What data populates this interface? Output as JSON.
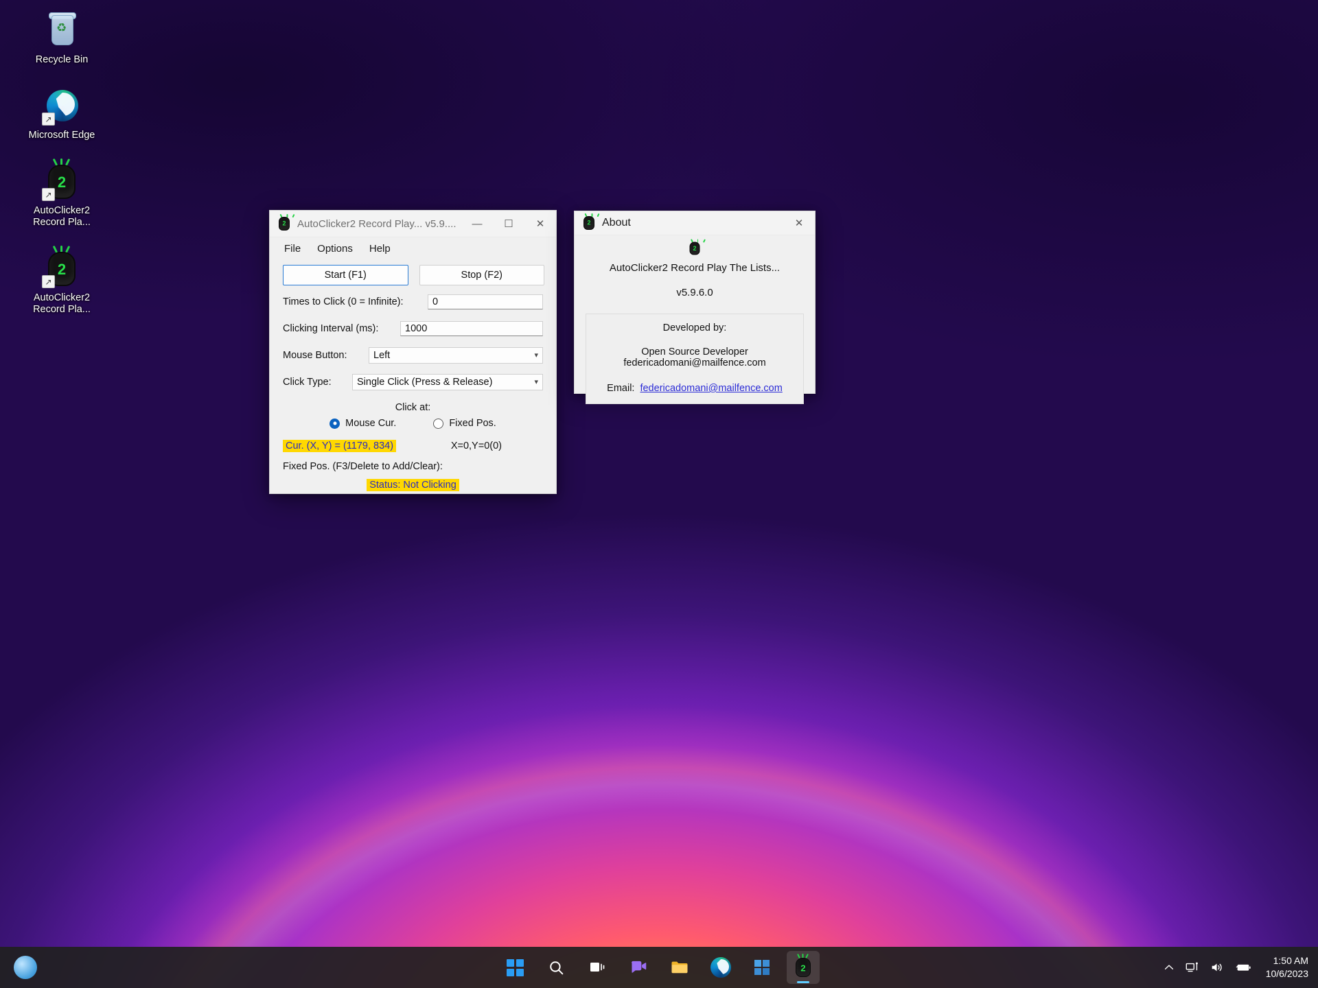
{
  "desktop": {
    "icons": [
      {
        "name": "Recycle Bin",
        "icon": "recycle-bin-icon",
        "shortcut": false
      },
      {
        "name": "Microsoft Edge",
        "icon": "edge-icon",
        "shortcut": true
      },
      {
        "name": "AutoClicker2 Record Pla...",
        "icon": "autoclicker-icon",
        "shortcut": true
      },
      {
        "name": "AutoClicker2 Record Pla...",
        "icon": "autoclicker-icon",
        "shortcut": true
      }
    ]
  },
  "main_window": {
    "title": "AutoClicker2 Record Play... v5.9....",
    "icon": "autoclicker-icon",
    "controls": {
      "minimize": "—",
      "maximize": "☐",
      "close": "✕"
    },
    "menu": [
      "File",
      "Options",
      "Help"
    ],
    "buttons": {
      "start": "Start (F1)",
      "stop": "Stop (F2)"
    },
    "fields": {
      "times_label": "Times to Click (0 = Infinite):",
      "times_value": "0",
      "interval_label": "Clicking Interval (ms):",
      "interval_value": "1000",
      "mouse_button_label": "Mouse Button:",
      "mouse_button_value": "Left",
      "click_type_label": "Click Type:",
      "click_type_value": "Single Click (Press & Release)"
    },
    "click_at": {
      "heading": "Click at:",
      "option_mouse": "Mouse Cur.",
      "option_fixed": "Fixed Pos.",
      "selected": "Mouse Cur."
    },
    "cursor_readout": "Cur. (X, Y) = (1179, 834)",
    "fixed_readout": "X=0,Y=0(0)",
    "fixed_pos_label": "Fixed Pos. (F3/Delete to Add/Clear):",
    "status": "Status:  Not Clicking",
    "highlight_bg": "#ffd800",
    "highlight_fg": "#2b2bbf",
    "accent": "#2a7bd4"
  },
  "about_window": {
    "title": "About",
    "icon": "autoclicker-icon",
    "close": "✕",
    "app_name": "AutoClicker2 Record Play The Lists...",
    "version": "v5.9.6.0",
    "developed_by_label": "Developed by:",
    "developer_name": "Open Source Developer",
    "developer_email": "federicadomani@mailfence.com",
    "email_label": "Email:",
    "email_link": "federicadomani@mailfence.com",
    "link_color": "#2b2bd6"
  },
  "taskbar": {
    "weather_icon": "weather-icon",
    "apps": [
      {
        "name": "start-button",
        "icon": "windows-logo-icon"
      },
      {
        "name": "search",
        "icon": "search-icon"
      },
      {
        "name": "task-view",
        "icon": "task-view-icon"
      },
      {
        "name": "chat",
        "icon": "chat-icon"
      },
      {
        "name": "file-explorer",
        "icon": "folder-icon"
      },
      {
        "name": "microsoft-edge",
        "icon": "edge-icon"
      },
      {
        "name": "microsoft-store",
        "icon": "store-icon"
      },
      {
        "name": "autoclicker2",
        "icon": "autoclicker-icon"
      }
    ],
    "tray": {
      "chevron": "chevron-up-icon",
      "network": "network-icon",
      "volume": "volume-icon",
      "battery": "battery-charging-icon"
    },
    "time": "1:50 AM",
    "date": "10/6/2023"
  }
}
